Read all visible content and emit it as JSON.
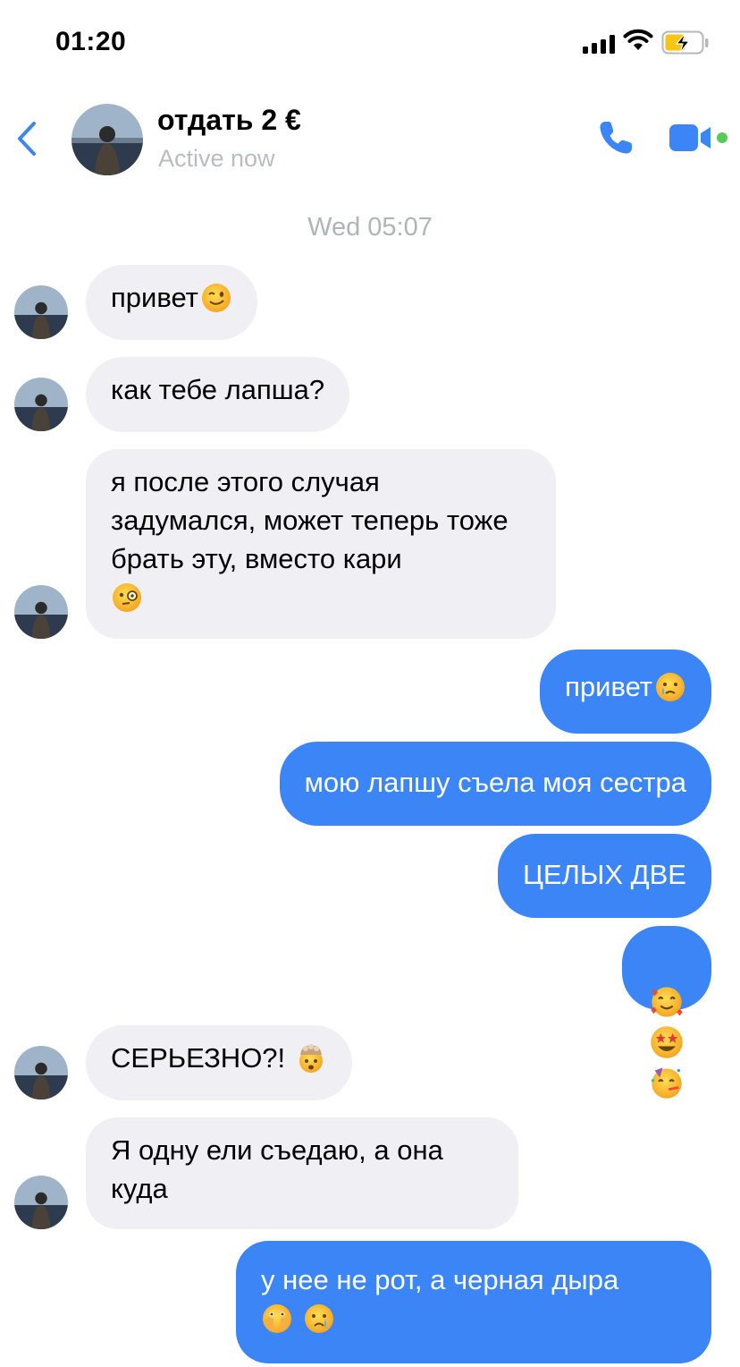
{
  "status_bar": {
    "time": "01:20",
    "icons": [
      "cellular-signal-icon",
      "wifi-icon",
      "battery-charging-icon"
    ]
  },
  "header": {
    "back_icon": "chevron-left-icon",
    "contact_name": "отдать 2 €",
    "presence": "Active now",
    "actions": [
      "phone-icon",
      "video-camera-icon"
    ],
    "accent_color": "#3b85f7",
    "online_color": "#5ac85a"
  },
  "thread": {
    "date_separator": "Wed 05:07",
    "messages": [
      {
        "from": "them",
        "text": "привет",
        "emoji": [
          "winking-face"
        ]
      },
      {
        "from": "them",
        "text": "как тебе лапша?"
      },
      {
        "from": "them",
        "text": "я после этого случая задумался, может теперь тоже брать эту, вместо кари",
        "emoji": [
          "face-with-monocle"
        ]
      },
      {
        "from": "me",
        "text": "привет",
        "emoji": [
          "crying-face"
        ]
      },
      {
        "from": "me",
        "text": "мою лапшу съела моя сестра"
      },
      {
        "from": "me",
        "text": "ЦЕЛЫХ ДВЕ"
      },
      {
        "from": "me",
        "text": "",
        "emoji": [
          "smiling-face-with-hearts",
          "star-struck",
          "partying-face"
        ]
      },
      {
        "from": "them",
        "text": "СЕРЬЕЗНО?!",
        "emoji": [
          "exploding-head"
        ]
      },
      {
        "from": "them",
        "text": "Я одну ели съедаю, а она куда"
      },
      {
        "from": "me",
        "text": "у нее не рот, а черная дыра",
        "emoji": [
          "face-with-hand-over-mouth",
          "crying-face"
        ]
      }
    ]
  },
  "colors": {
    "incoming_bubble": "#efeff4",
    "outgoing_bubble": "#3b85f7",
    "muted_text": "#b0b3b8"
  }
}
